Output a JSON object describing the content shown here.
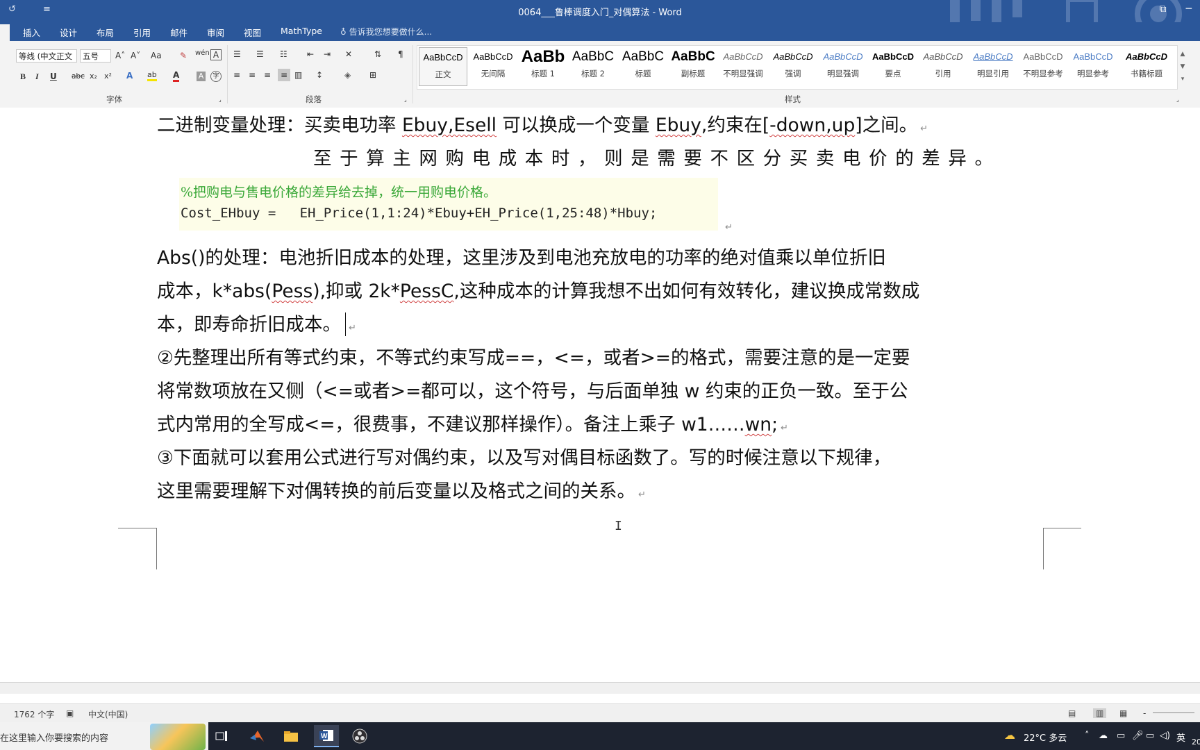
{
  "window": {
    "title": "0064___鲁棒调度入门_对偶算法 - Word",
    "ribbon_display_icon": "ribbon-display-icon",
    "quick_access_icons": [
      "redo-icon",
      "customize-quick-access-icon"
    ]
  },
  "ribbon_tabs": [
    "插入",
    "设计",
    "布局",
    "引用",
    "邮件",
    "审阅",
    "视图",
    "MathType"
  ],
  "tell_me": "告诉我您想要做什么...",
  "font_group": {
    "label": "字体",
    "font_name": "等线 (中文正文",
    "font_size": "五号",
    "buttons": {
      "bold": "B",
      "italic": "I",
      "underline": "U",
      "strike": "abc",
      "subscript": "x₂",
      "superscript": "x²",
      "grow": "A˄",
      "shrink": "A˅",
      "case": "Aa",
      "text_effect": "A",
      "highlight": "ab",
      "font_color": "A",
      "char_shade": "A",
      "enclose": "字"
    }
  },
  "paragraph_group": {
    "label": "段落"
  },
  "styles_group": {
    "label": "样式",
    "items": [
      {
        "preview": "AaBbCcD",
        "name": "正文"
      },
      {
        "preview": "AaBbCcD",
        "name": "无间隔"
      },
      {
        "preview": "AaBb",
        "name": "标题 1"
      },
      {
        "preview": "AaBbC",
        "name": "标题 2"
      },
      {
        "preview": "AaBbC",
        "name": "标题"
      },
      {
        "preview": "AaBbC",
        "name": "副标题"
      },
      {
        "preview": "AaBbCcD",
        "name": "不明显强调"
      },
      {
        "preview": "AaBbCcD",
        "name": "强调"
      },
      {
        "preview": "AaBbCcD",
        "name": "明显强调"
      },
      {
        "preview": "AaBbCcD",
        "name": "要点"
      },
      {
        "preview": "AaBbCcD",
        "name": "引用"
      },
      {
        "preview": "AaBbCcD",
        "name": "明显引用"
      },
      {
        "preview": "AaBbCcD",
        "name": "不明显参考"
      },
      {
        "preview": "AaBbCcD",
        "name": "明显参考"
      },
      {
        "preview": "AaBbCcD",
        "name": "书籍标题"
      }
    ]
  },
  "document": {
    "line1": {
      "a": "二进制变量处理：买卖电功率 ",
      "b": "Ebuy,Esell",
      "c": " 可以换成一个变量 ",
      "d": "Ebuy",
      "e": ",约束在[",
      "f": "-down,up",
      "g": "]之间。"
    },
    "line2": "至于算主网购电成本时，则是需要不区分买卖电价的差异。",
    "code_comment": "%把购电与售电价格的差异给去掉，统一用购电价格。",
    "code_line": "Cost_EHbuy =   EH_Price(1,1:24)*Ebuy+EH_Price(1,25:48)*Hbuy;",
    "abs_l1": "Abs()的处理：电池折旧成本的处理，这里涉及到电池充放电的功率的绝对值乘以单位折旧",
    "abs_l2a": "成本，k*abs(",
    "abs_l2b": "Pess",
    "abs_l2c": "),抑或 2k*",
    "abs_l2d": "PessC",
    "abs_l2e": ",这种成本的计算我想不出如何有效转化，建议换成常数成",
    "abs_l3": "本，即寿命折旧成本。",
    "p2_l1": "②先整理出所有等式约束，不等式约束写成==，<=，或者>=的格式，需要注意的是一定要",
    "p2_l2": "将常数项放在又侧（<=或者>=都可以，这个符号，与后面单独 w 约束的正负一致。至于公",
    "p2_l3a": "式内常用的全写成<=，很费事，不建议那样操作）。备注上乘子 w1……",
    "p2_l3b": "wn",
    "p2_l3c": ";",
    "p3_l1": "③下面就可以套用公式进行写对偶约束，以及写对偶目标函数了。写的时候注意以下规律，",
    "p3_l2": "这里需要理解下对偶转换的前后变量以及格式之间的关系。",
    "para_mark": "↵"
  },
  "status": {
    "word_count": "1762 个字",
    "language": "中文(中国)",
    "proof_icon": "proofing-icon",
    "views": [
      "read-mode-icon",
      "print-layout-icon",
      "web-layout-icon"
    ],
    "zoom_out": "-"
  },
  "taskbar": {
    "search_placeholder": "在这里输入你要搜索的内容",
    "apps": [
      "task-view-icon",
      "matlab-icon",
      "file-explorer-icon",
      "word-icon",
      "obs-icon"
    ],
    "weather": "22°C 多云",
    "ime": "英",
    "clock_fragment": "20"
  }
}
